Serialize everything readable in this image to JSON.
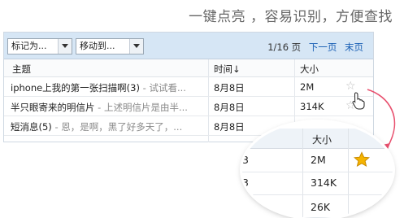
{
  "headline": "一键点亮 ，容易识别，方便查找",
  "toolbar": {
    "mark_as": "标记为...",
    "move_to": "移动到...",
    "page_info": "1/16 页",
    "next_page": "下一页",
    "last_page": "末页"
  },
  "columns": {
    "subject": "主题",
    "time": "时间↓",
    "size": "大小"
  },
  "rows": [
    {
      "subject": "iphone上我的第一张扫描啊(3)",
      "snippet": " - 试试看...",
      "date": "8月8日",
      "size": "2M",
      "star": "☆"
    },
    {
      "subject": "半只眼寄来的明信片",
      "snippet": " - 上述明信片是由半...",
      "date": "8月8日",
      "size": "314K",
      "star": "☆"
    },
    {
      "subject": "短消息(5)",
      "snippet": " - 恩，是啊，黑了好多天了，...",
      "date": "8月8日",
      "size": "",
      "star": ""
    }
  ],
  "zoom": {
    "size_header": "大小",
    "rows": [
      {
        "date_fragment": "3",
        "size": "2M",
        "starred": true
      },
      {
        "date_fragment": "3",
        "size": "314K",
        "starred": false
      },
      {
        "date_fragment": "",
        "size": "26K",
        "starred": false
      }
    ]
  },
  "colors": {
    "toolbar_bg": "#d6e6f5",
    "link": "#1a5fb4",
    "star_active": "#f5b400",
    "arrow": "#e8506e"
  }
}
